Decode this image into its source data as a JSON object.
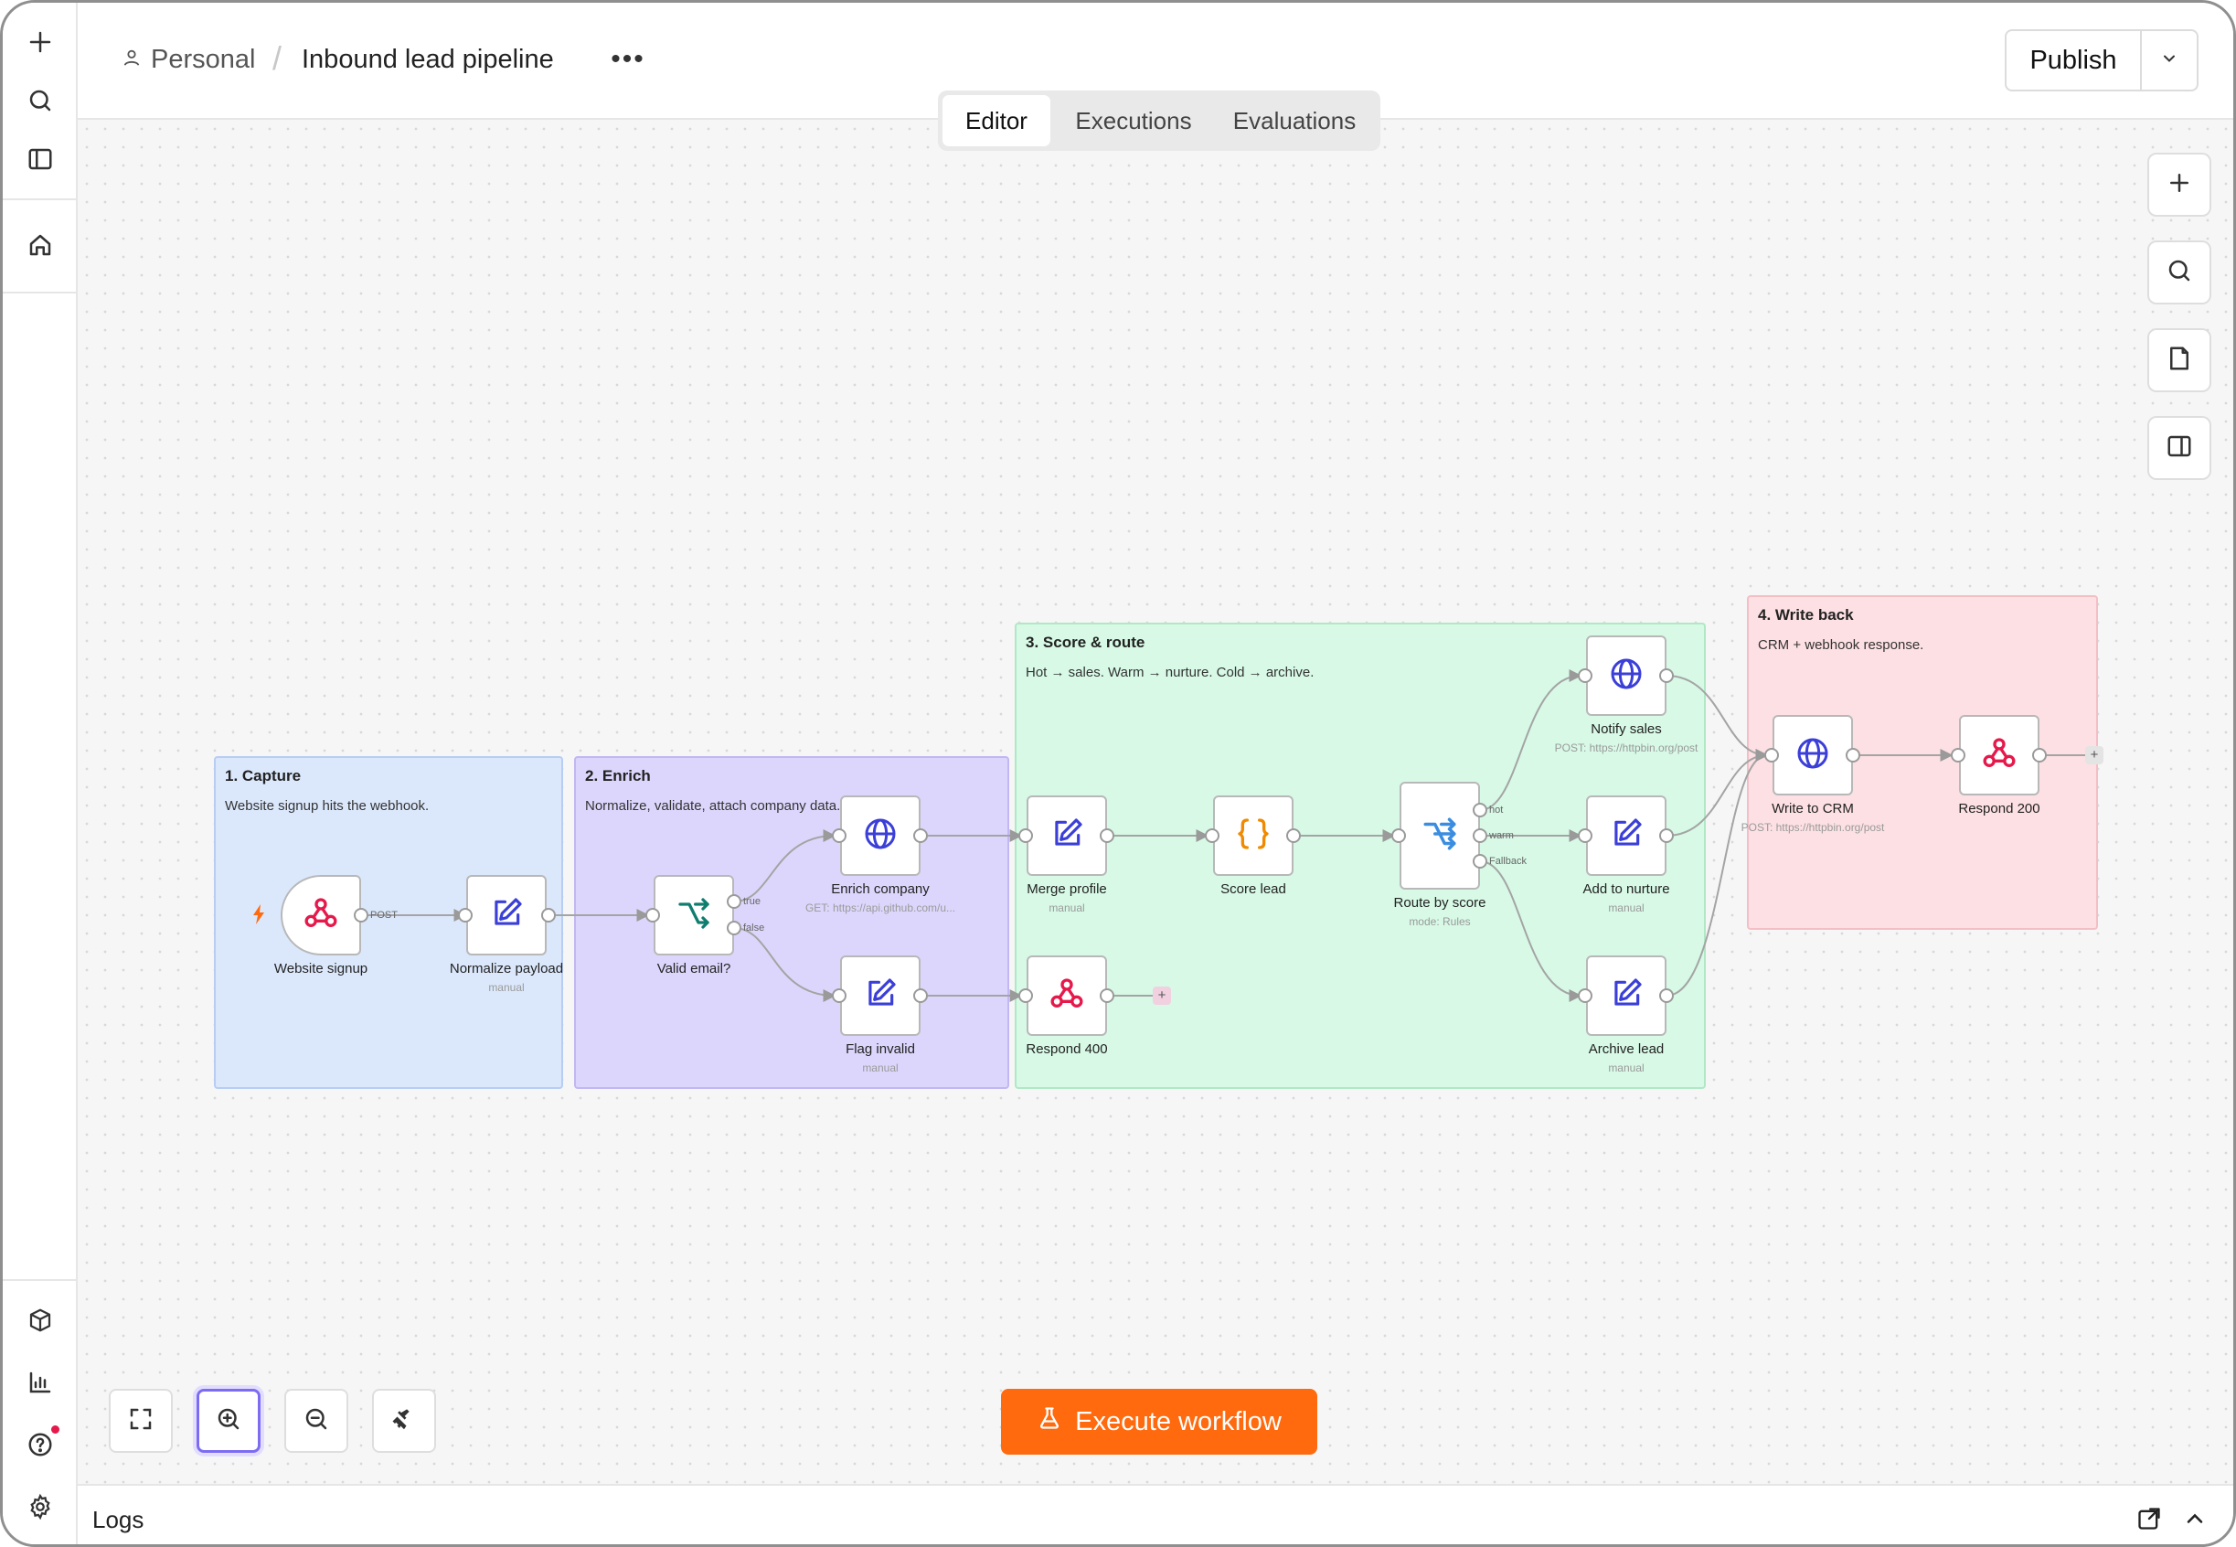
{
  "header": {
    "workspace": "Personal",
    "separator": "/",
    "workflow_name": "Inbound lead pipeline",
    "more_label": "•••",
    "publish_label": "Publish"
  },
  "tabs": [
    {
      "label": "Editor",
      "active": true
    },
    {
      "label": "Executions",
      "active": false
    },
    {
      "label": "Evaluations",
      "active": false
    }
  ],
  "rail_icons": [
    "plus-icon",
    "search-icon",
    "sidebar-panel-icon",
    "home-icon",
    "package-icon",
    "chart-icon",
    "help-icon",
    "gear-icon"
  ],
  "canvas_tools": [
    "plus-icon",
    "search-icon",
    "sticky-note-icon",
    "panel-icon"
  ],
  "groups": [
    {
      "title": "1. Capture",
      "desc": "Website signup hits the webhook.",
      "color": "#dbe8fc"
    },
    {
      "title": "2. Enrich",
      "desc": "Normalize, validate, attach company data.",
      "color": "#ddd6fc"
    },
    {
      "title": "3. Score & route",
      "desc": "Hot → sales. Warm → nurture. Cold → archive.",
      "color": "#d7f9e6"
    },
    {
      "title": "4. Write back",
      "desc": "CRM + webhook response.",
      "color": "#fde0e3"
    }
  ],
  "nodes": {
    "website_signup": {
      "label": "Website signup",
      "icon": "webhook-icon"
    },
    "normalize_payload": {
      "label": "Normalize payload",
      "sub": "manual",
      "icon": "edit-icon"
    },
    "valid_email": {
      "label": "Valid email?",
      "icon": "if-branch-icon"
    },
    "enrich_company": {
      "label": "Enrich company",
      "sub": "GET: https://api.github.com/u...",
      "icon": "globe-icon"
    },
    "flag_invalid": {
      "label": "Flag invalid",
      "sub": "manual",
      "icon": "edit-icon"
    },
    "merge_profile": {
      "label": "Merge profile",
      "sub": "manual",
      "icon": "edit-icon"
    },
    "respond_400": {
      "label": "Respond 400",
      "icon": "webhook-icon"
    },
    "score_lead": {
      "label": "Score lead",
      "icon": "code-braces-icon"
    },
    "route_by_score": {
      "label": "Route by score",
      "sub": "mode: Rules",
      "icon": "switch-icon"
    },
    "notify_sales": {
      "label": "Notify sales",
      "sub": "POST: https://httpbin.org/post",
      "icon": "globe-icon"
    },
    "add_to_nurture": {
      "label": "Add to nurture",
      "sub": "manual",
      "icon": "edit-icon"
    },
    "archive_lead": {
      "label": "Archive lead",
      "sub": "manual",
      "icon": "edit-icon"
    },
    "write_to_crm": {
      "label": "Write to CRM",
      "sub": "POST: https://httpbin.org/post",
      "icon": "globe-icon"
    },
    "respond_200": {
      "label": "Respond 200",
      "icon": "webhook-icon"
    }
  },
  "port_labels": {
    "post": "POST",
    "true": "true",
    "false": "false",
    "hot": "hot",
    "warm": "warm",
    "fallback": "Fallback"
  },
  "plus_label": "+",
  "execute_label": "Execute workflow",
  "logs_label": "Logs",
  "colors": {
    "accent": "#ff6a0e",
    "webhook": "#e5194b",
    "globe": "#3b3fd8",
    "edit": "#3b3fd8",
    "if": "#0f7e6f",
    "code": "#f08a00",
    "switch": "#3b8de0",
    "trigger_bolt": "#ff6a0e"
  }
}
